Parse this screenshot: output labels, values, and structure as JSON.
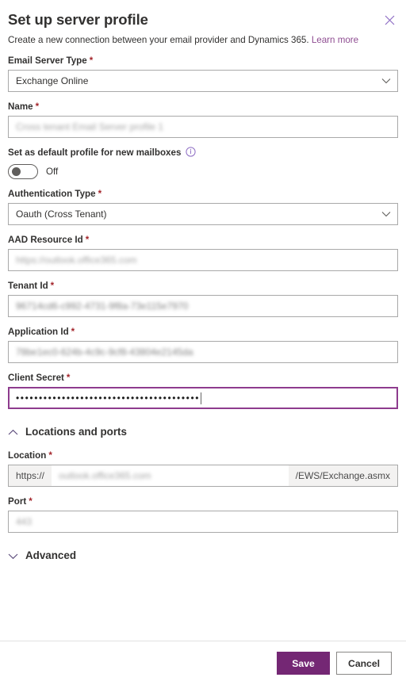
{
  "dialog": {
    "title": "Set up server profile",
    "subtitle_text": "Create a new connection between your email provider and Dynamics 365.",
    "learn_more_label": "Learn more",
    "close_icon": "close-icon"
  },
  "fields": {
    "email_server_type": {
      "label": "Email Server Type",
      "required_marker": "*",
      "value": "Exchange Online",
      "icon": "chevron-down-icon"
    },
    "name": {
      "label": "Name",
      "required_marker": "*",
      "value": "Cross tenant Email Server profile 1"
    },
    "default_profile": {
      "label": "Set as default profile for new mailboxes",
      "info_icon": "info-icon",
      "toggle_state": "Off"
    },
    "authentication_type": {
      "label": "Authentication Type",
      "required_marker": "*",
      "value": "Oauth (Cross Tenant)",
      "icon": "chevron-down-icon"
    },
    "aad_resource_id": {
      "label": "AAD Resource Id",
      "required_marker": "*",
      "value": "https://outlook.office365.com"
    },
    "tenant_id": {
      "label": "Tenant Id",
      "required_marker": "*",
      "value": "96714cd6-c992-4731-9f8a-73e115e7970"
    },
    "application_id": {
      "label": "Application Id",
      "required_marker": "*",
      "value": "78be1ec0-624b-4c9c-9cf8-43804e2145da"
    },
    "client_secret": {
      "label": "Client Secret",
      "required_marker": "*",
      "masked_value": "••••••••••••••••••••••••••••••••••••••••",
      "focused": true
    },
    "location": {
      "label": "Location",
      "required_marker": "*",
      "prefix": "https://",
      "value": "outlook.office365.com",
      "suffix": "/EWS/Exchange.asmx"
    },
    "port": {
      "label": "Port",
      "required_marker": "*",
      "value": "443"
    }
  },
  "sections": {
    "locations_and_ports": {
      "title": "Locations and ports",
      "icon": "chevron-up-icon",
      "expanded": true
    },
    "advanced": {
      "title": "Advanced",
      "icon": "chevron-down-icon",
      "expanded": false
    }
  },
  "footer": {
    "save_label": "Save",
    "cancel_label": "Cancel"
  },
  "colors": {
    "accent_purple": "#742774",
    "link_purple": "#8e4c91",
    "required_red": "#a4262c",
    "focus_border": "#8e3c8e",
    "text": "#323130"
  }
}
